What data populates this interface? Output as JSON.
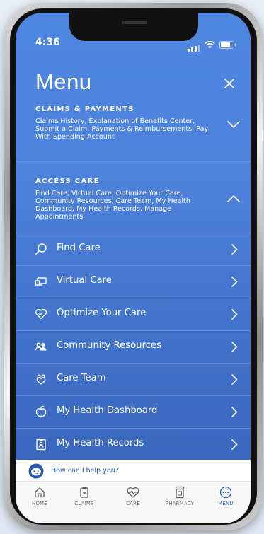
{
  "status": {
    "time": "4:36"
  },
  "header": {
    "title": "Menu"
  },
  "sections": [
    {
      "title": "CLAIMS & PAYMENTS",
      "description": "Claims History, Explanation of Benefits Center, Submit a Claim, Payments & Reimbursements, Pay With Spending Account",
      "expanded": false
    },
    {
      "title": "ACCESS CARE",
      "description": "Find Care, Virtual Care, Optimize Your Care, Community Resources, Care Team, My Health Dashboard, My Health Records, Manage Appointments",
      "expanded": true
    }
  ],
  "items": [
    {
      "label": "Find Care",
      "icon": "search-icon"
    },
    {
      "label": "Virtual Care",
      "icon": "laptop-icon"
    },
    {
      "label": "Optimize Your Care",
      "icon": "heart-icon"
    },
    {
      "label": "Community Resources",
      "icon": "people-icon"
    },
    {
      "label": "Care Team",
      "icon": "care-team-icon"
    },
    {
      "label": "My Health Dashboard",
      "icon": "apple-icon"
    },
    {
      "label": "My Health Records",
      "icon": "records-icon"
    }
  ],
  "chat": {
    "prompt": "How can I help you?"
  },
  "tabs": [
    {
      "label": "HOME",
      "icon": "home-icon",
      "active": false
    },
    {
      "label": "CLAIMS",
      "icon": "clipboard-icon",
      "active": false
    },
    {
      "label": "CARE",
      "icon": "heartbeat-icon",
      "active": false
    },
    {
      "label": "PHARMACY",
      "icon": "pharmacy-icon",
      "active": false
    },
    {
      "label": "MENU",
      "icon": "more-icon",
      "active": true
    }
  ],
  "colors": {
    "accent": "#2d5eb8",
    "screen_top": "#4f86e0",
    "screen_bottom": "#3561b8"
  }
}
